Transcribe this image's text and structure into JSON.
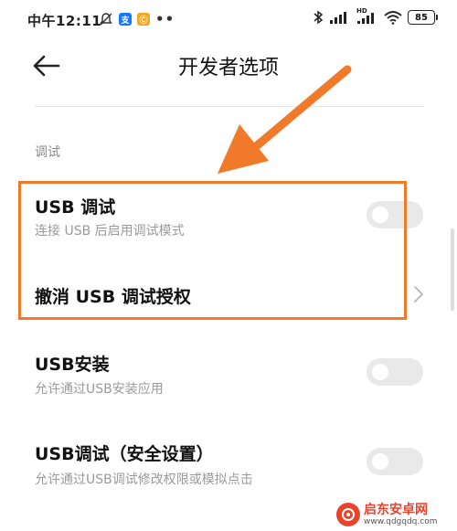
{
  "status_bar": {
    "time": "中午12:11",
    "app_badge_1": "支",
    "app_badge_2": "Ⓒ",
    "overflow_dots": "••",
    "battery_level": "85",
    "network_label": "HD"
  },
  "header": {
    "title": "开发者选项"
  },
  "section": {
    "label": "调试"
  },
  "settings": [
    {
      "title": "USB 调试",
      "subtitle": "连接 USB 后启用调试模式",
      "control": "toggle",
      "enabled": false
    },
    {
      "title": "撤消 USB 调试授权",
      "subtitle": "",
      "control": "chevron"
    },
    {
      "title": "USB安装",
      "subtitle": "允许通过USB安装应用",
      "control": "toggle",
      "enabled": false
    },
    {
      "title": "USB调试（安全设置）",
      "subtitle": "允许通过USB调试修改权限或模拟点击",
      "control": "toggle",
      "enabled": false
    }
  ],
  "watermark": {
    "name": "启东安卓网",
    "url": "www.qdgqdq.com"
  },
  "colors": {
    "annotation": "#f07a2a",
    "toggle_off": "#e9e9e9",
    "watermark": "#e8432c"
  }
}
